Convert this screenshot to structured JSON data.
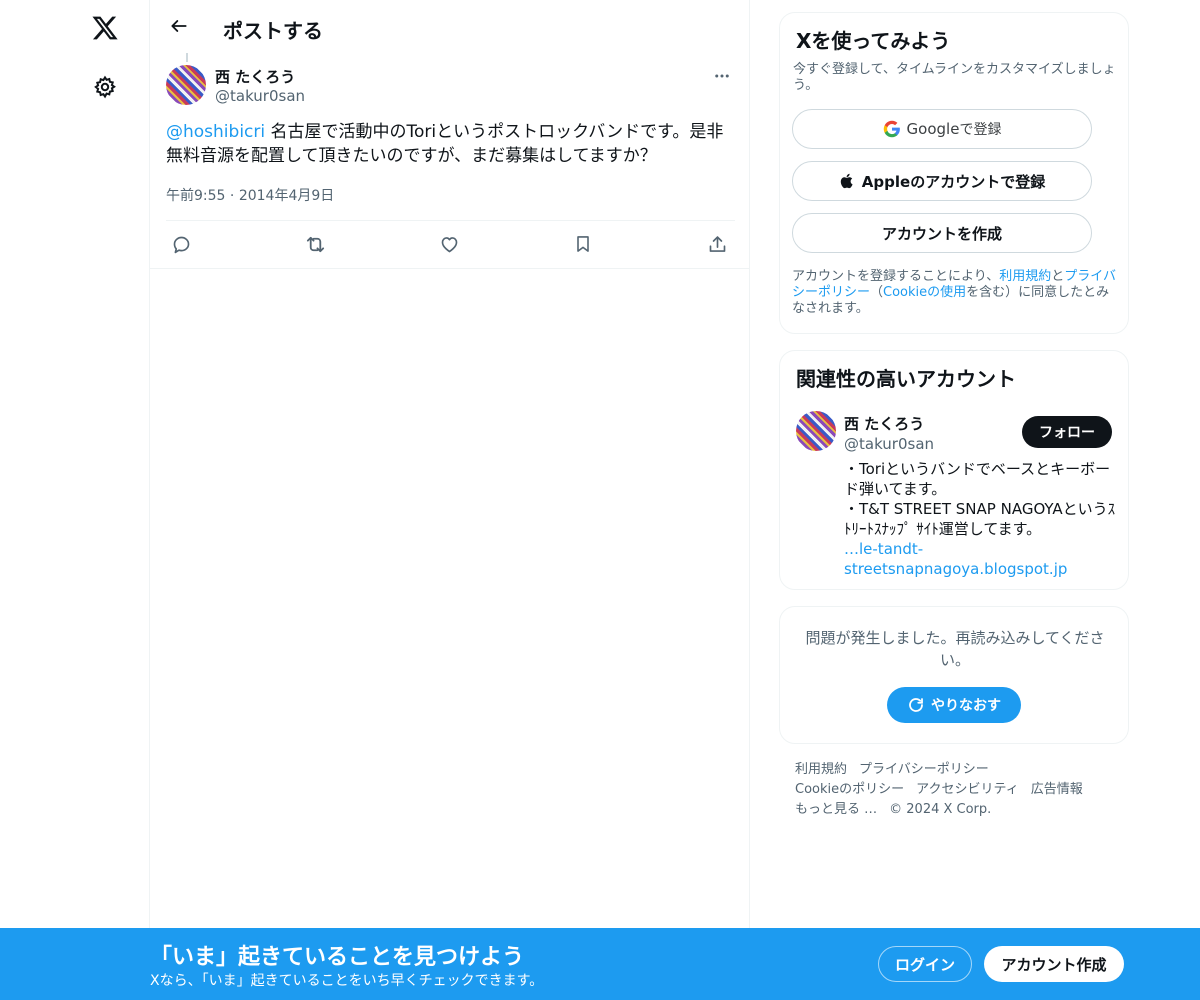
{
  "main": {
    "title": "ポストする",
    "post": {
      "author_name": "西 たくろう",
      "author_handle": "@takur0san",
      "mention": "@hoshibicri",
      "text": " 名古屋で活動中のToriというポストロックバンドです。是非無料音源を配置して頂きたいのですが、まだ募集はしてますか？",
      "time": "午前9:55",
      "date_sep": " · ",
      "date": "2014年4月9日"
    }
  },
  "sidebar": {
    "signup": {
      "title": "Xを使ってみよう",
      "subtitle": "今すぐ登録して、タイムラインをカスタマイズしましょう。",
      "google_word": "Google",
      "google_suffix": " で登録",
      "apple_label": "Appleのアカウントで登録",
      "create_label": "アカウントを作成",
      "legal_prefix": "アカウントを登録することにより、",
      "legal_terms": "利用規約",
      "legal_and": "と",
      "legal_privacy": "プライバシーポリシー",
      "legal_mid": "（",
      "legal_cookie": "Cookieの使用",
      "legal_suffix": "を含む）に同意したとみなされます。"
    },
    "related": {
      "title": "関連性の高いアカウント",
      "name": "西 たくろう",
      "handle": "@takur0san",
      "follow_label": "フォロー",
      "bio_line1": "・Toriというバンドでベースとキーボード弾いてます。",
      "bio_line2": "・T&T STREET SNAP NAGOYAというｽﾄﾘｰﾄｽﾅｯﾌﾟ ｻｲﾄ運営してます。",
      "bio_link": "…le-tandt-streetsnapnagoya.blogspot.jp"
    },
    "error": {
      "message": "問題が発生しました。再読み込みしてください。",
      "retry_label": "やりなおす"
    },
    "footer": {
      "terms": "利用規約",
      "privacy": "プライバシーポリシー",
      "cookie": "Cookieのポリシー",
      "accessibility": "アクセシビリティ",
      "ads": "広告情報",
      "more": "もっと見る …",
      "copyright": "© 2024 X Corp."
    }
  },
  "banner": {
    "title": "「いま」起きていることを見つけよう",
    "subtitle": "Xなら、「いま」起きていることをいち早くチェックできます。",
    "login_label": "ログイン",
    "signup_label": "アカウント作成"
  },
  "colors": {
    "accent": "#1d9bf0",
    "text_primary": "#0f1419",
    "text_secondary": "#536471",
    "border": "#eff3f4"
  },
  "icons": {
    "logo": "x-logo-icon",
    "settings": "gear-icon",
    "back": "arrow-left-icon",
    "more": "more-horizontal-icon",
    "reply": "reply-icon",
    "repost": "repost-icon",
    "like": "heart-icon",
    "bookmark": "bookmark-icon",
    "share": "share-icon",
    "google": "google-icon",
    "apple": "apple-icon",
    "refresh": "refresh-icon"
  }
}
